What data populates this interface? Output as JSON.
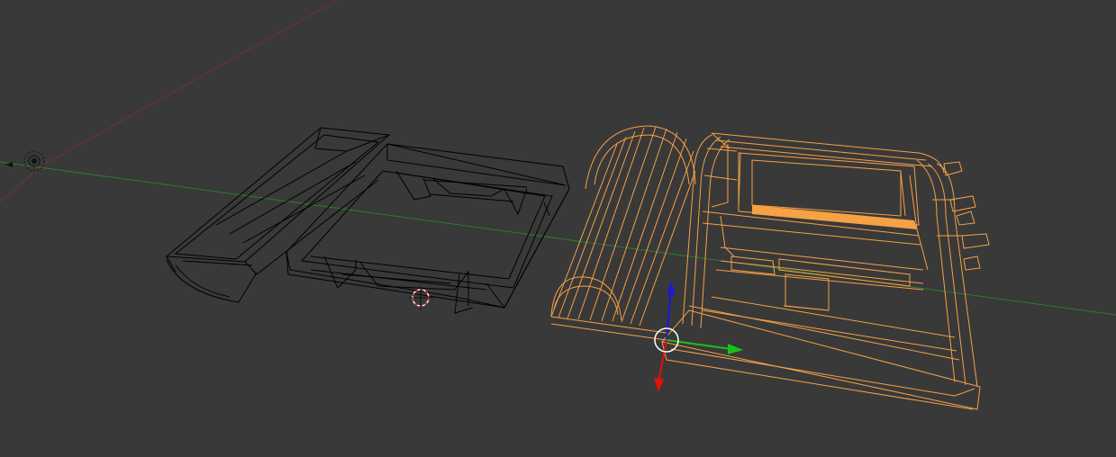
{
  "viewport": {
    "background": "#393939",
    "axes": {
      "x_axis_color": "#7a2f2f",
      "y_axis_color": "#2f7a2f"
    },
    "objects": [
      {
        "name": "unselected-mesh",
        "state": "unselected",
        "wire_color": "#000000"
      },
      {
        "name": "selected-mesh",
        "state": "selected",
        "wire_color": "#f5a144"
      }
    ],
    "gizmo": {
      "x_color": "#e01010",
      "y_color": "#18c018",
      "z_color": "#1a1ad8"
    },
    "icons": [
      "3d-cursor-icon",
      "lamp-icon",
      "object-origin-icon",
      "transform-gizmo-icon"
    ]
  }
}
